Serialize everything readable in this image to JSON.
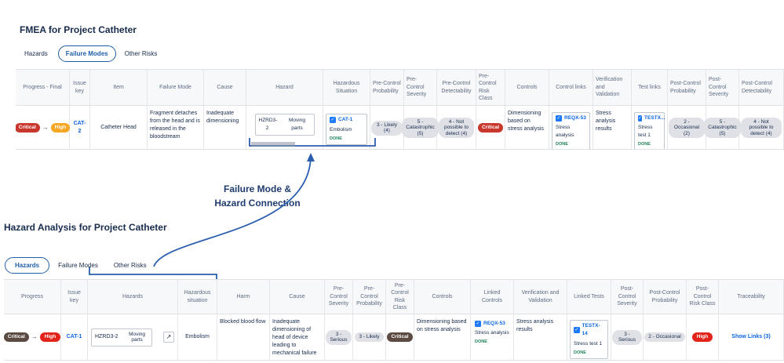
{
  "fmea": {
    "title": "FMEA for Project Catheter",
    "tabs": [
      "Hazards",
      "Failure Modes",
      "Other Risks"
    ],
    "headers": [
      "Progress - Final",
      "Issue key",
      "Item",
      "Failure Mode",
      "Cause",
      "Hazard",
      "Hazardous Situation",
      "Pre-Control Probability",
      "Pre-Control Severity",
      "Pre-Control Detectability",
      "Pre-Control Risk Class",
      "Controls",
      "Control links",
      "Verification and Validation",
      "Test links",
      "Post-Control Probability",
      "Post-Control Severity",
      "Post-Control Detectability"
    ],
    "row": {
      "progress_from": "Critical",
      "progress_to": "High",
      "issue_key": "CAT-2",
      "item": "Catheter Head",
      "failure_mode": "Fragment detaches from the head and is released in the bloodstream",
      "cause": "Inadequate dimensioning",
      "hazard_key": "HZRD3-2",
      "hazard_name": "Moving parts",
      "situation_key": "CAT-1",
      "situation_name": "Embolism",
      "situation_status": "DONE",
      "pre_probability": "3 - Likely (4)",
      "pre_severity": "5 - Catastrophic (5)",
      "pre_detectability": "4 - Not possible to detect (4)",
      "pre_risk_class": "Critical",
      "controls": "Dimensioning based on stress analysis",
      "control_link_key": "REQX-53",
      "control_link_name": "Stress analysis",
      "control_link_status": "DONE",
      "verification": "Stress analysis results",
      "test_key": "TESTX...",
      "test_name": "Stress test 1",
      "test_status": "DONE",
      "post_probability": "2 - Occasional (2)",
      "post_severity": "5 - Catastrophic (5)",
      "post_detectability": "4 - Not possible to detect (4)"
    }
  },
  "callout": {
    "line1": "Failure Mode &",
    "line2": "Hazard Connection"
  },
  "ha": {
    "title": "Hazard Analysis for Project Catheter",
    "tabs": [
      "Hazards",
      "Failure Modes",
      "Other Risks"
    ],
    "headers": [
      "Progress",
      "Issue key",
      "Hazards",
      "Hazardous situation",
      "Harm",
      "Cause",
      "Pre-Control Severity",
      "Pre-Control Probability",
      "Pre-Control Risk Class",
      "Controls",
      "Linked Controls",
      "Verification and Validation",
      "Linked Tests",
      "Post-Control Severity",
      "Post-Control Probability",
      "Post-Control Risk Class",
      "Traceability"
    ],
    "row": {
      "progress_from": "Critical",
      "progress_to": "High",
      "issue_key": "CAT-1",
      "hazard_key": "HZRD3-2",
      "hazard_name": "Moving parts",
      "open_icon": "↗",
      "situation": "Embolism",
      "harm": "Blocked blood flow",
      "cause": "Inadequate dimensioning of head of device leading to mechanical failure",
      "pre_severity": "3 - Serious",
      "pre_probability": "3 - Likely",
      "pre_risk_class": "Critical",
      "controls": "Dimensioning based on stress analysis",
      "linked_control_key": "REQX-53",
      "linked_control_name": "Stress analysis",
      "linked_control_status": "DONE",
      "verification": "Stress analysis results",
      "linked_test_key": "TESTX-14",
      "linked_test_name": "Stress test 1",
      "linked_test_status": "DONE",
      "post_severity": "3 - Serious",
      "post_probability": "2 - Occasional",
      "post_risk_class": "High",
      "traceability": "Show Links (3)"
    }
  },
  "colors": {
    "critical": "#c9372c",
    "high_orange": "#f5a623",
    "high_red": "#e2231a",
    "link": "#0c66e4",
    "done": "#1f845a",
    "accent": "#1f5fa8"
  },
  "icons": {
    "arrow": "→",
    "check": "✓"
  }
}
